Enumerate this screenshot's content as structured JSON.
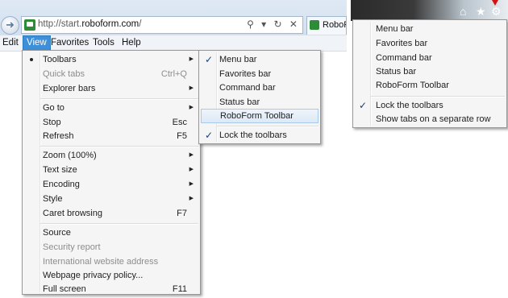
{
  "browser": {
    "url_prefix": "http://start.",
    "url_domain": "roboform.com",
    "url_suffix": "/",
    "tab_label": "RoboForm",
    "back_icon": "back-arrow-icon",
    "addr_icons": "⚲ ▾ ↻ ✕"
  },
  "menubar": {
    "items": [
      "Edit",
      "View",
      "Favorites",
      "Tools",
      "Help"
    ],
    "active": "View"
  },
  "view_menu": {
    "items": [
      {
        "label": "Toolbars",
        "arrow": true,
        "selected_dot": true
      },
      {
        "label": "Quick tabs",
        "shortcut": "Ctrl+Q",
        "disabled": true
      },
      {
        "label": "Explorer bars",
        "arrow": true
      },
      {
        "label": "Go to",
        "arrow": true
      },
      {
        "label": "Stop",
        "shortcut": "Esc"
      },
      {
        "label": "Refresh",
        "shortcut": "F5"
      },
      {
        "label": "Zoom (100%)",
        "arrow": true
      },
      {
        "label": "Text size",
        "arrow": true
      },
      {
        "label": "Encoding",
        "arrow": true
      },
      {
        "label": "Style",
        "arrow": true
      },
      {
        "label": "Caret browsing",
        "shortcut": "F7"
      },
      {
        "label": "Source"
      },
      {
        "label": "Security report",
        "disabled": true
      },
      {
        "label": "International website address",
        "disabled": true
      },
      {
        "label": "Webpage privacy policy..."
      },
      {
        "label": "Full screen",
        "shortcut": "F11"
      }
    ]
  },
  "toolbars_submenu": {
    "items": [
      {
        "label": "Menu bar",
        "checked": true
      },
      {
        "label": "Favorites bar"
      },
      {
        "label": "Command bar"
      },
      {
        "label": "Status bar"
      },
      {
        "label": "RoboForm Toolbar",
        "hover": true
      },
      {
        "label": "Lock the toolbars",
        "checked": true
      }
    ]
  },
  "context_menu": {
    "items": [
      {
        "label": "Menu bar"
      },
      {
        "label": "Favorites bar"
      },
      {
        "label": "Command bar"
      },
      {
        "label": "Status bar"
      },
      {
        "label": "RoboForm Toolbar"
      },
      {
        "label": "Lock the toolbars",
        "checked": true
      },
      {
        "label": "Show tabs on a separate row"
      }
    ]
  },
  "toolbar_icons": {
    "home": "⌂",
    "favorites": "★",
    "settings": "⚙"
  },
  "colors": {
    "menu_highlight": "#3c8fd8",
    "marker": "#d21313"
  }
}
